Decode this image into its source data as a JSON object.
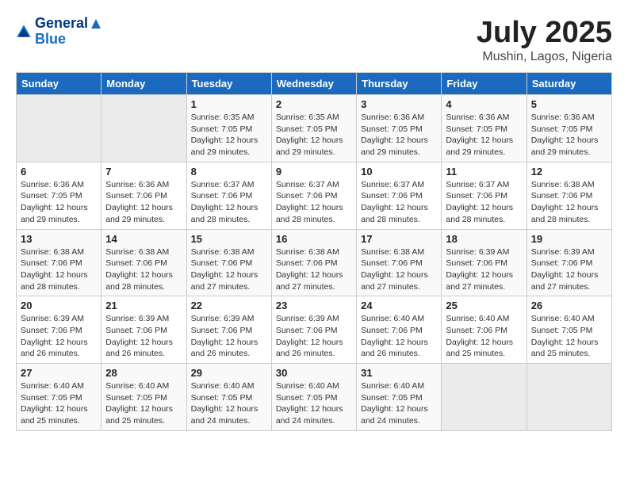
{
  "header": {
    "logo_line1": "General",
    "logo_line2": "Blue",
    "month": "July 2025",
    "location": "Mushin, Lagos, Nigeria"
  },
  "days_of_week": [
    "Sunday",
    "Monday",
    "Tuesday",
    "Wednesday",
    "Thursday",
    "Friday",
    "Saturday"
  ],
  "weeks": [
    [
      {
        "day": "",
        "info": ""
      },
      {
        "day": "",
        "info": ""
      },
      {
        "day": "1",
        "info": "Sunrise: 6:35 AM\nSunset: 7:05 PM\nDaylight: 12 hours and 29 minutes."
      },
      {
        "day": "2",
        "info": "Sunrise: 6:35 AM\nSunset: 7:05 PM\nDaylight: 12 hours and 29 minutes."
      },
      {
        "day": "3",
        "info": "Sunrise: 6:36 AM\nSunset: 7:05 PM\nDaylight: 12 hours and 29 minutes."
      },
      {
        "day": "4",
        "info": "Sunrise: 6:36 AM\nSunset: 7:05 PM\nDaylight: 12 hours and 29 minutes."
      },
      {
        "day": "5",
        "info": "Sunrise: 6:36 AM\nSunset: 7:05 PM\nDaylight: 12 hours and 29 minutes."
      }
    ],
    [
      {
        "day": "6",
        "info": "Sunrise: 6:36 AM\nSunset: 7:05 PM\nDaylight: 12 hours and 29 minutes."
      },
      {
        "day": "7",
        "info": "Sunrise: 6:36 AM\nSunset: 7:06 PM\nDaylight: 12 hours and 29 minutes."
      },
      {
        "day": "8",
        "info": "Sunrise: 6:37 AM\nSunset: 7:06 PM\nDaylight: 12 hours and 28 minutes."
      },
      {
        "day": "9",
        "info": "Sunrise: 6:37 AM\nSunset: 7:06 PM\nDaylight: 12 hours and 28 minutes."
      },
      {
        "day": "10",
        "info": "Sunrise: 6:37 AM\nSunset: 7:06 PM\nDaylight: 12 hours and 28 minutes."
      },
      {
        "day": "11",
        "info": "Sunrise: 6:37 AM\nSunset: 7:06 PM\nDaylight: 12 hours and 28 minutes."
      },
      {
        "day": "12",
        "info": "Sunrise: 6:38 AM\nSunset: 7:06 PM\nDaylight: 12 hours and 28 minutes."
      }
    ],
    [
      {
        "day": "13",
        "info": "Sunrise: 6:38 AM\nSunset: 7:06 PM\nDaylight: 12 hours and 28 minutes."
      },
      {
        "day": "14",
        "info": "Sunrise: 6:38 AM\nSunset: 7:06 PM\nDaylight: 12 hours and 28 minutes."
      },
      {
        "day": "15",
        "info": "Sunrise: 6:38 AM\nSunset: 7:06 PM\nDaylight: 12 hours and 27 minutes."
      },
      {
        "day": "16",
        "info": "Sunrise: 6:38 AM\nSunset: 7:06 PM\nDaylight: 12 hours and 27 minutes."
      },
      {
        "day": "17",
        "info": "Sunrise: 6:38 AM\nSunset: 7:06 PM\nDaylight: 12 hours and 27 minutes."
      },
      {
        "day": "18",
        "info": "Sunrise: 6:39 AM\nSunset: 7:06 PM\nDaylight: 12 hours and 27 minutes."
      },
      {
        "day": "19",
        "info": "Sunrise: 6:39 AM\nSunset: 7:06 PM\nDaylight: 12 hours and 27 minutes."
      }
    ],
    [
      {
        "day": "20",
        "info": "Sunrise: 6:39 AM\nSunset: 7:06 PM\nDaylight: 12 hours and 26 minutes."
      },
      {
        "day": "21",
        "info": "Sunrise: 6:39 AM\nSunset: 7:06 PM\nDaylight: 12 hours and 26 minutes."
      },
      {
        "day": "22",
        "info": "Sunrise: 6:39 AM\nSunset: 7:06 PM\nDaylight: 12 hours and 26 minutes."
      },
      {
        "day": "23",
        "info": "Sunrise: 6:39 AM\nSunset: 7:06 PM\nDaylight: 12 hours and 26 minutes."
      },
      {
        "day": "24",
        "info": "Sunrise: 6:40 AM\nSunset: 7:06 PM\nDaylight: 12 hours and 26 minutes."
      },
      {
        "day": "25",
        "info": "Sunrise: 6:40 AM\nSunset: 7:06 PM\nDaylight: 12 hours and 25 minutes."
      },
      {
        "day": "26",
        "info": "Sunrise: 6:40 AM\nSunset: 7:05 PM\nDaylight: 12 hours and 25 minutes."
      }
    ],
    [
      {
        "day": "27",
        "info": "Sunrise: 6:40 AM\nSunset: 7:05 PM\nDaylight: 12 hours and 25 minutes."
      },
      {
        "day": "28",
        "info": "Sunrise: 6:40 AM\nSunset: 7:05 PM\nDaylight: 12 hours and 25 minutes."
      },
      {
        "day": "29",
        "info": "Sunrise: 6:40 AM\nSunset: 7:05 PM\nDaylight: 12 hours and 24 minutes."
      },
      {
        "day": "30",
        "info": "Sunrise: 6:40 AM\nSunset: 7:05 PM\nDaylight: 12 hours and 24 minutes."
      },
      {
        "day": "31",
        "info": "Sunrise: 6:40 AM\nSunset: 7:05 PM\nDaylight: 12 hours and 24 minutes."
      },
      {
        "day": "",
        "info": ""
      },
      {
        "day": "",
        "info": ""
      }
    ]
  ]
}
